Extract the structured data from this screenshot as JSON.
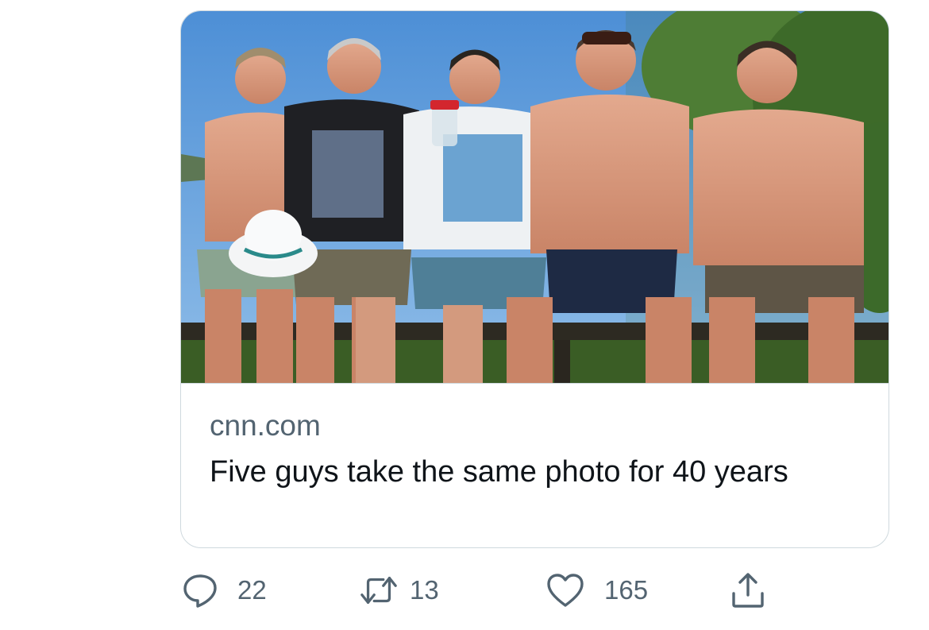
{
  "card": {
    "domain": "cnn.com",
    "headline": "Five guys take the same photo for 40 years"
  },
  "actions": {
    "reply": {
      "icon": "reply-icon",
      "count": "22"
    },
    "retweet": {
      "icon": "retweet-icon",
      "count": "13"
    },
    "like": {
      "icon": "heart-icon",
      "count": "165"
    },
    "share": {
      "icon": "share-icon"
    }
  },
  "colors": {
    "secondary_text": "#536471",
    "primary_text": "#0f1419",
    "border": "#cfd9de"
  }
}
